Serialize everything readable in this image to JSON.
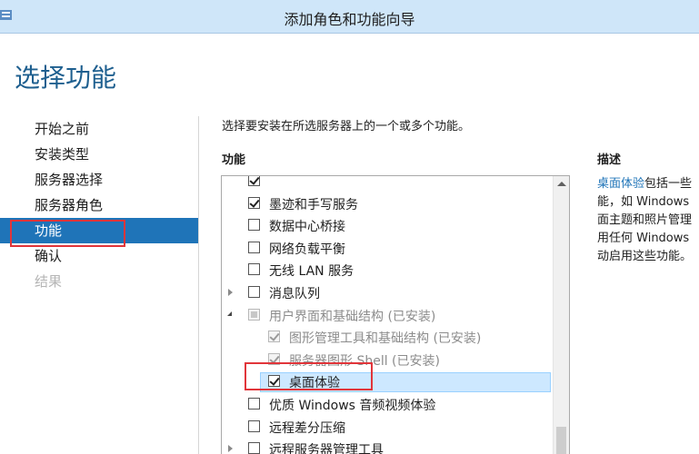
{
  "window": {
    "title": "添加角色和功能向导"
  },
  "page": {
    "title": "选择功能"
  },
  "nav": {
    "items": [
      {
        "label": "开始之前",
        "state": "normal"
      },
      {
        "label": "安装类型",
        "state": "normal"
      },
      {
        "label": "服务器选择",
        "state": "normal"
      },
      {
        "label": "服务器角色",
        "state": "normal"
      },
      {
        "label": "功能",
        "state": "active"
      },
      {
        "label": "确认",
        "state": "normal"
      },
      {
        "label": "结果",
        "state": "disabled"
      }
    ]
  },
  "main": {
    "intro": "选择要安装在所选服务器上的一个或多个功能。",
    "features_label": "功能",
    "features": [
      {
        "label": "",
        "checked": true,
        "partial": false,
        "disabled": false,
        "expander": "none",
        "indent": 0
      },
      {
        "label": "墨迹和手写服务",
        "checked": true,
        "partial": false,
        "disabled": false,
        "expander": "none",
        "indent": 0
      },
      {
        "label": "数据中心桥接",
        "checked": false,
        "partial": false,
        "disabled": false,
        "expander": "none",
        "indent": 0
      },
      {
        "label": "网络负载平衡",
        "checked": false,
        "partial": false,
        "disabled": false,
        "expander": "none",
        "indent": 0
      },
      {
        "label": "无线 LAN 服务",
        "checked": false,
        "partial": false,
        "disabled": false,
        "expander": "none",
        "indent": 0
      },
      {
        "label": "消息队列",
        "checked": false,
        "partial": false,
        "disabled": false,
        "expander": "collapsed",
        "indent": 0
      },
      {
        "label": "用户界面和基础结构 (已安装)",
        "checked": false,
        "partial": true,
        "disabled": true,
        "expander": "expanded",
        "indent": 0
      },
      {
        "label": "图形管理工具和基础结构 (已安装)",
        "checked": true,
        "partial": false,
        "disabled": true,
        "expander": "none",
        "indent": 1
      },
      {
        "label": "服务器图形 Shell (已安装)",
        "checked": true,
        "partial": false,
        "disabled": true,
        "expander": "none",
        "indent": 1
      },
      {
        "label": "桌面体验",
        "checked": true,
        "partial": false,
        "disabled": false,
        "expander": "none",
        "indent": 1,
        "selected": true
      },
      {
        "label": "优质 Windows 音频视频体验",
        "checked": false,
        "partial": false,
        "disabled": false,
        "expander": "none",
        "indent": 0
      },
      {
        "label": "远程差分压缩",
        "checked": false,
        "partial": false,
        "disabled": false,
        "expander": "none",
        "indent": 0
      },
      {
        "label": "远程服务器管理工具",
        "checked": false,
        "partial": false,
        "disabled": false,
        "expander": "collapsed",
        "indent": 0
      }
    ]
  },
  "description": {
    "label": "描述",
    "link": "桌面体验",
    "lines": [
      "包括一些",
      "能，如 Windows",
      "面主题和照片管理",
      "用任何 Windows",
      "动启用这些功能。"
    ]
  },
  "colors": {
    "accent": "#1f74b8",
    "highlight": "#e1353a",
    "titlebar": "#cfe6f9"
  }
}
